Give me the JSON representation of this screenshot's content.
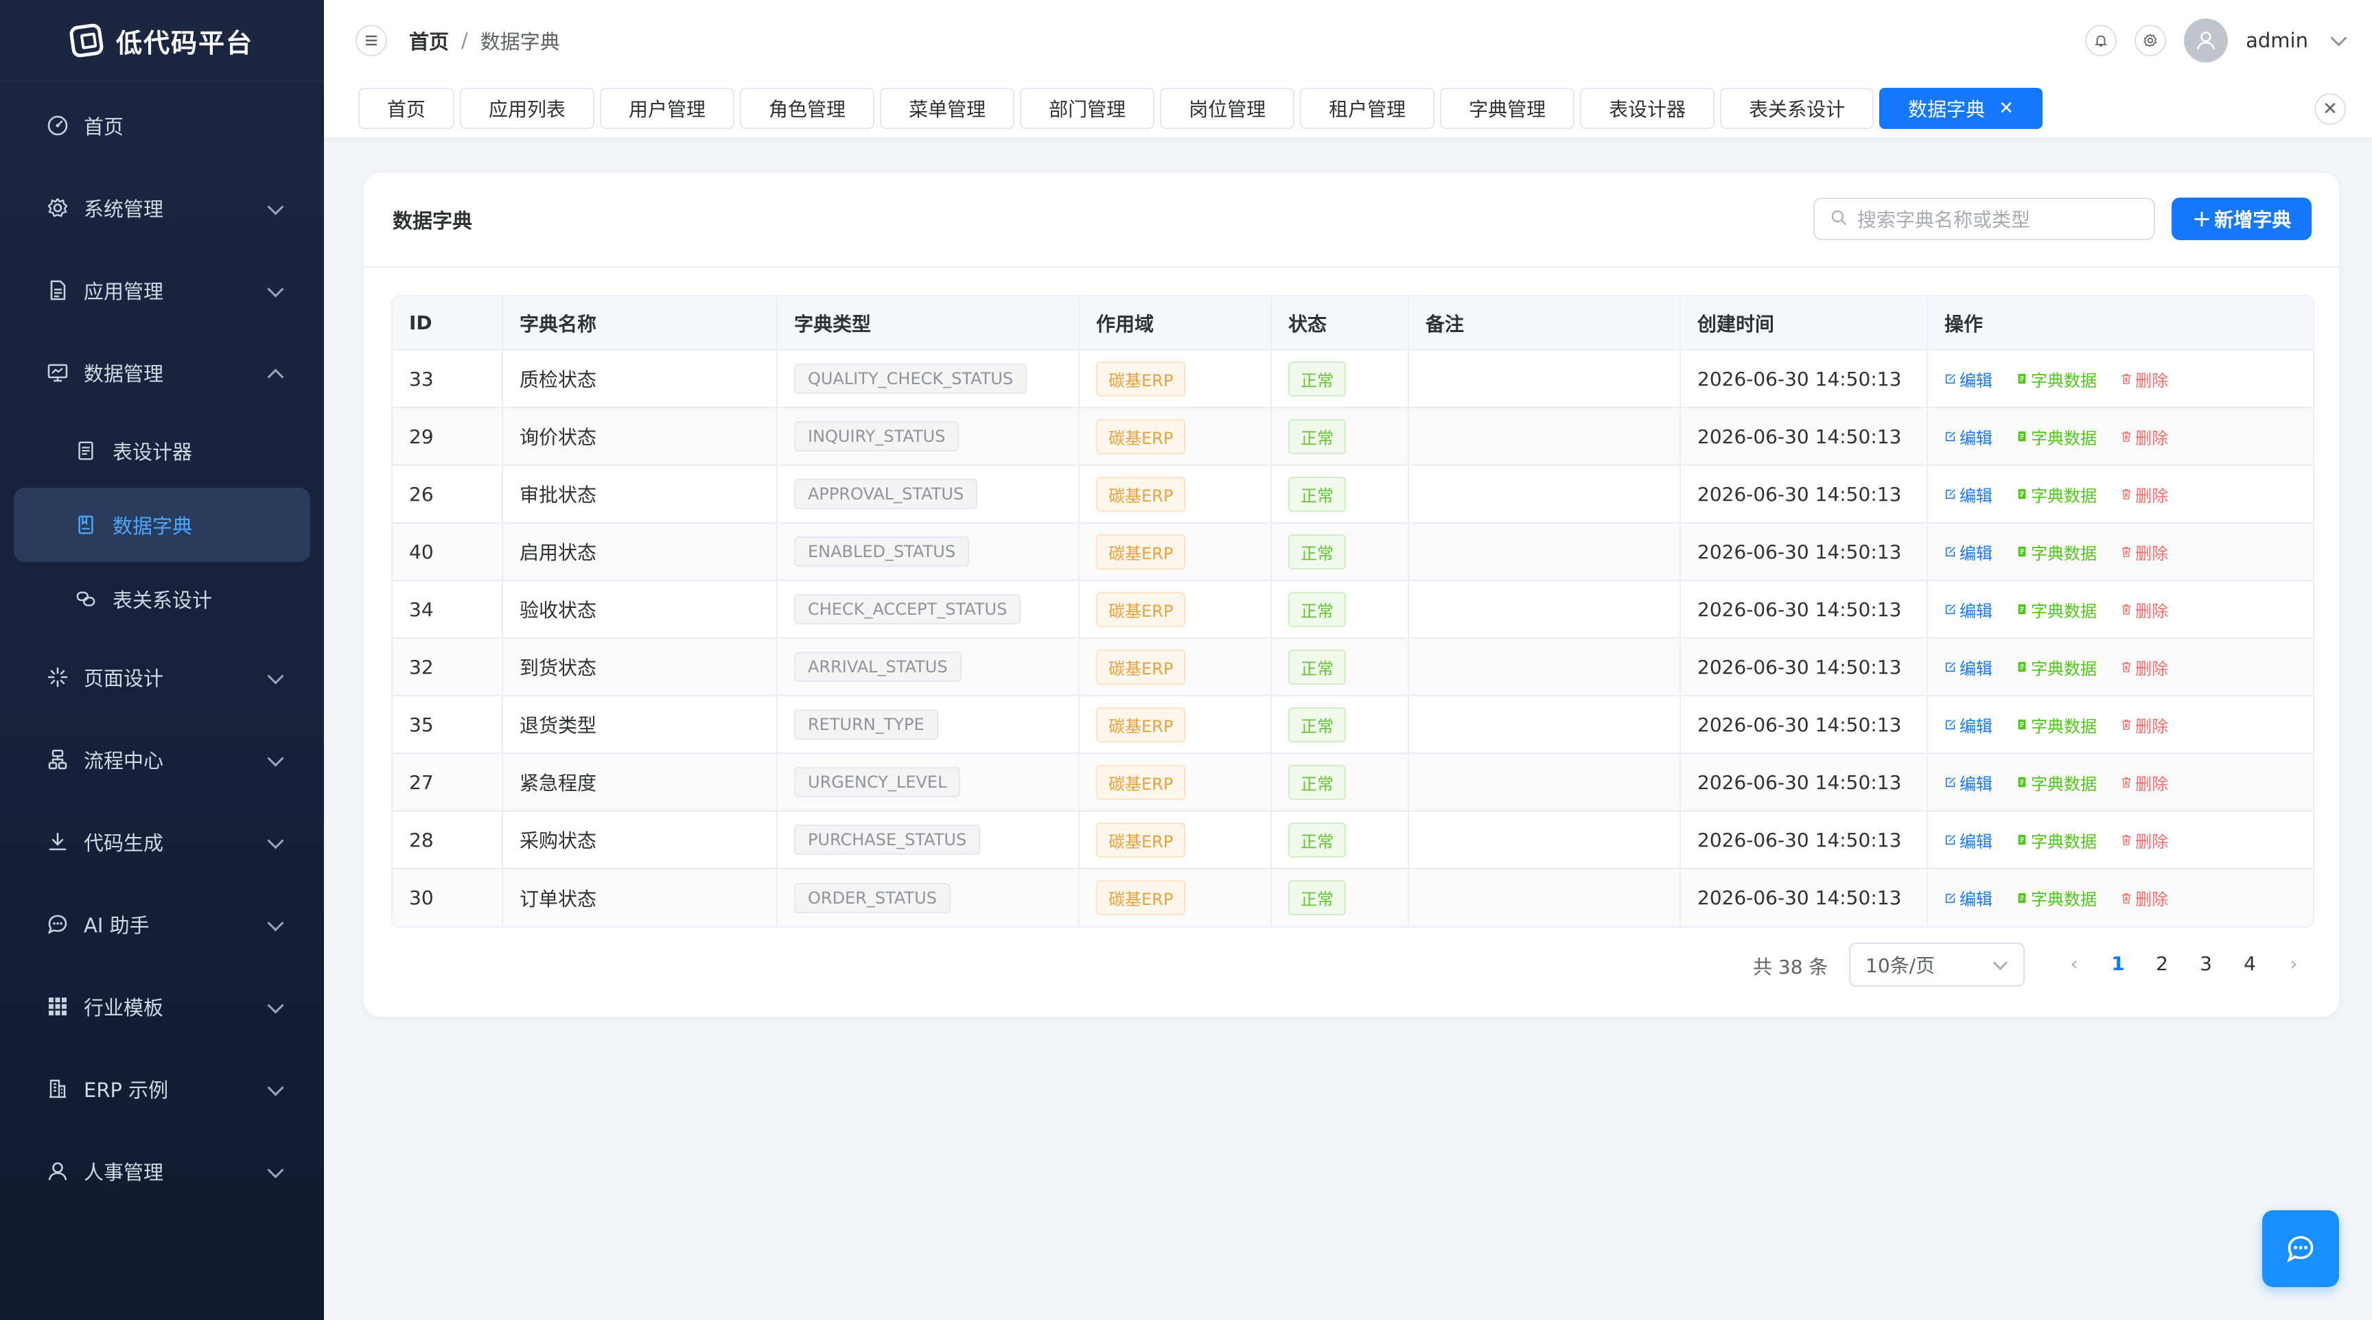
{
  "app": {
    "title": "低代码平台"
  },
  "sidebar": {
    "items": [
      {
        "label": "首页",
        "icon": "dashboard-icon"
      },
      {
        "label": "系统管理",
        "icon": "gear-icon"
      },
      {
        "label": "应用管理",
        "icon": "document-icon"
      },
      {
        "label": "数据管理",
        "icon": "monitor-icon",
        "expanded": true
      },
      {
        "label": "页面设计",
        "icon": "sparkle-icon"
      },
      {
        "label": "流程中心",
        "icon": "flow-icon"
      },
      {
        "label": "代码生成",
        "icon": "download-icon"
      },
      {
        "label": "AI 助手",
        "icon": "chat-bubble-icon"
      },
      {
        "label": "行业模板",
        "icon": "grid-icon"
      },
      {
        "label": "ERP 示例",
        "icon": "building-icon"
      },
      {
        "label": "人事管理",
        "icon": "user-icon"
      }
    ],
    "subitems": [
      {
        "label": "表设计器",
        "icon": "table-doc-icon"
      },
      {
        "label": "数据字典",
        "icon": "book-icon",
        "active": true
      },
      {
        "label": "表关系设计",
        "icon": "link-icon"
      }
    ]
  },
  "header": {
    "breadcrumb": [
      "首页",
      "数据字典"
    ],
    "breadcrumb_sep": "/",
    "username": "admin"
  },
  "tabs": [
    {
      "label": "首页"
    },
    {
      "label": "应用列表"
    },
    {
      "label": "用户管理"
    },
    {
      "label": "角色管理"
    },
    {
      "label": "菜单管理"
    },
    {
      "label": "部门管理"
    },
    {
      "label": "岗位管理"
    },
    {
      "label": "租户管理"
    },
    {
      "label": "字典管理"
    },
    {
      "label": "表设计器"
    },
    {
      "label": "表关系设计"
    },
    {
      "label": "数据字典",
      "active": true,
      "closable": true
    }
  ],
  "card": {
    "title": "数据字典",
    "search_placeholder": "搜索字典名称或类型",
    "add_button": "新增字典",
    "add_plus": "+"
  },
  "table": {
    "columns": [
      "ID",
      "字典名称",
      "字典类型",
      "作用域",
      "状态",
      "备注",
      "创建时间",
      "操作"
    ],
    "rows": [
      {
        "id": "33",
        "name": "质检状态",
        "type": "QUALITY_CHECK_STATUS",
        "scope": "碳基ERP",
        "status": "正常",
        "remark": "",
        "created": "2026-06-30 14:50:13"
      },
      {
        "id": "29",
        "name": "询价状态",
        "type": "INQUIRY_STATUS",
        "scope": "碳基ERP",
        "status": "正常",
        "remark": "",
        "created": "2026-06-30 14:50:13"
      },
      {
        "id": "26",
        "name": "审批状态",
        "type": "APPROVAL_STATUS",
        "scope": "碳基ERP",
        "status": "正常",
        "remark": "",
        "created": "2026-06-30 14:50:13"
      },
      {
        "id": "40",
        "name": "启用状态",
        "type": "ENABLED_STATUS",
        "scope": "碳基ERP",
        "status": "正常",
        "remark": "",
        "created": "2026-06-30 14:50:13"
      },
      {
        "id": "34",
        "name": "验收状态",
        "type": "CHECK_ACCEPT_STATUS",
        "scope": "碳基ERP",
        "status": "正常",
        "remark": "",
        "created": "2026-06-30 14:50:13"
      },
      {
        "id": "32",
        "name": "到货状态",
        "type": "ARRIVAL_STATUS",
        "scope": "碳基ERP",
        "status": "正常",
        "remark": "",
        "created": "2026-06-30 14:50:13"
      },
      {
        "id": "35",
        "name": "退货类型",
        "type": "RETURN_TYPE",
        "scope": "碳基ERP",
        "status": "正常",
        "remark": "",
        "created": "2026-06-30 14:50:13"
      },
      {
        "id": "27",
        "name": "紧急程度",
        "type": "URGENCY_LEVEL",
        "scope": "碳基ERP",
        "status": "正常",
        "remark": "",
        "created": "2026-06-30 14:50:13"
      },
      {
        "id": "28",
        "name": "采购状态",
        "type": "PURCHASE_STATUS",
        "scope": "碳基ERP",
        "status": "正常",
        "remark": "",
        "created": "2026-06-30 14:50:13"
      },
      {
        "id": "30",
        "name": "订单状态",
        "type": "ORDER_STATUS",
        "scope": "碳基ERP",
        "status": "正常",
        "remark": "",
        "created": "2026-06-30 14:50:13"
      }
    ],
    "actions": {
      "edit": "编辑",
      "data": "字典数据",
      "delete": "删除"
    }
  },
  "pagination": {
    "total_text": "共 38 条",
    "page_size": "10条/页",
    "pages": [
      "1",
      "2",
      "3",
      "4"
    ],
    "current": "1"
  },
  "colors": {
    "primary": "#1677ff",
    "success": "#52c41a",
    "danger": "#f56c6c",
    "warning": "#e6a23c",
    "sidebar_bg": "#1b2741"
  }
}
